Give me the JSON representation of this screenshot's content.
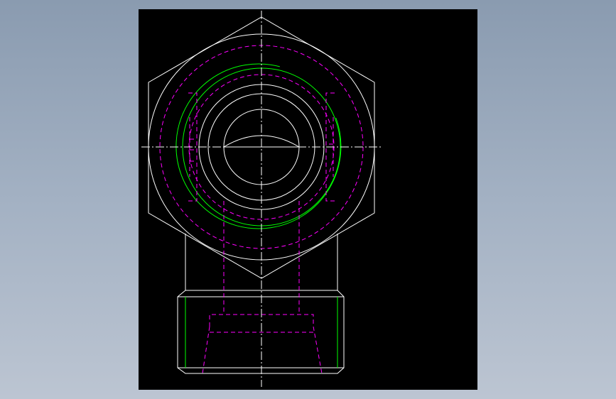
{
  "canvas": {
    "background": "#000000",
    "app_background_top": "#8a9bb0",
    "app_background_bottom": "#bcc5d2"
  },
  "colors": {
    "visible_edge": "#ffffff",
    "hidden_edge": "#ff00ff",
    "thread_edge": "#00ff00",
    "center_line": "#ffffff"
  },
  "drawing": {
    "views": [
      "hex-nut-end-view",
      "threaded-shank-side-view"
    ],
    "line_types": [
      "continuous",
      "dashed-hidden",
      "dash-dot-center"
    ]
  }
}
